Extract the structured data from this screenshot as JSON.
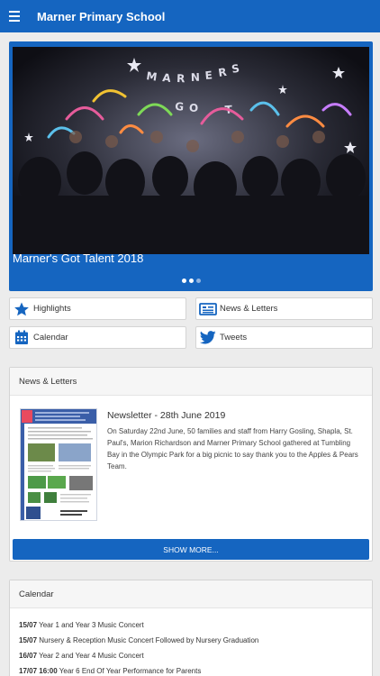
{
  "appbar": {
    "title": "Marner Primary School",
    "menu_icon": "hamburger-menu-icon"
  },
  "hero": {
    "caption": "Marner's Got Talent 2018",
    "banner_text": "MARNERS GOT TALENT",
    "slides": 3,
    "active_slide": 1
  },
  "quick_links": {
    "highlights": {
      "label": "Highlights",
      "icon": "star-icon"
    },
    "news": {
      "label": "News & Letters",
      "icon": "newspaper-icon"
    },
    "calendar": {
      "label": "Calendar",
      "icon": "calendar-icon"
    },
    "tweets": {
      "label": "Tweets",
      "icon": "twitter-icon"
    }
  },
  "news_section": {
    "heading": "News & Letters",
    "item_title": "Newsletter - 28th June 2019",
    "item_body": "On Saturday 22nd June, 50 families and staff from Harry Gosling, Shapla, St. Paul's, Marion Richardson and Marner Primary School gathered at Tumbling Bay in the Olympic Park for a big picnic to say thank you to the Apples & Pears Team.",
    "show_more": "SHOW MORE..."
  },
  "calendar_section": {
    "heading": "Calendar",
    "events": [
      {
        "date": "15/07",
        "text": "Year 1 and Year 3 Music Concert"
      },
      {
        "date": "15/07",
        "text": "Nursery & Reception Music Concert Followed by Nursery Graduation"
      },
      {
        "date": "16/07",
        "text": "Year 2 and Year 4 Music Concert"
      },
      {
        "date": "17/07 16:00",
        "text": "Year 6 End Of Year Performance for Parents"
      }
    ]
  },
  "colors": {
    "primary": "#1565c0",
    "background": "#ececec",
    "card": "#ffffff"
  }
}
